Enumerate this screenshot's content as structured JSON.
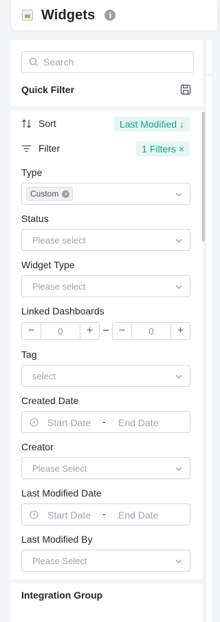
{
  "header": {
    "title": "Widgets",
    "info_icon": "info-icon",
    "logo_icon": "broken-image-icon"
  },
  "search": {
    "placeholder": "Search"
  },
  "quick_filter": {
    "label": "Quick Filter"
  },
  "sort": {
    "label": "Sort",
    "value": "Last Modified ↓"
  },
  "filter": {
    "label": "Filter",
    "value": "1 Filters ×"
  },
  "fields": {
    "type": {
      "label": "Type",
      "tag": "Custom"
    },
    "status": {
      "label": "Status",
      "placeholder": "Please select"
    },
    "widget_type": {
      "label": "Widget Type",
      "placeholder": "Please select"
    },
    "linked_dashboards": {
      "label": "Linked Dashboards",
      "min": "0",
      "max": "0",
      "minus": "−",
      "plus": "+",
      "dash": "–"
    },
    "tag": {
      "label": "Tag",
      "placeholder": "select"
    },
    "created_date": {
      "label": "Created Date",
      "start": "Start Date",
      "sep": "-",
      "end": "End Date"
    },
    "creator": {
      "label": "Creator",
      "placeholder": "Please Select"
    },
    "last_modified_date": {
      "label": "Last Modified Date",
      "start": "Start Date",
      "sep": "-",
      "end": "End Date"
    },
    "last_modified_by": {
      "label": "Last Modified By",
      "placeholder": "Please Select"
    }
  },
  "integration_group": {
    "label": "Integration Group"
  },
  "colors": {
    "accent": "#16a383",
    "accent_bg": "#e6f7f3",
    "border": "#d4d7dc",
    "placeholder": "#a0a5ad"
  }
}
